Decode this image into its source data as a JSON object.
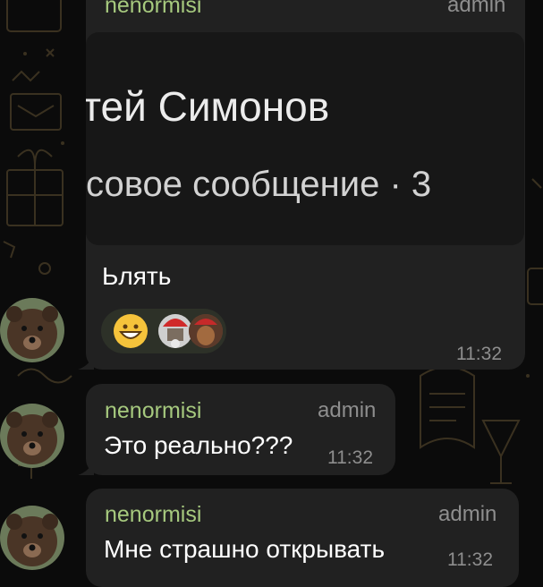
{
  "messages": [
    {
      "sender": "nenormisi",
      "role": "admin",
      "preview_name": "тей Симонов",
      "preview_subtitle": "совое сообщение · 3",
      "text": "Ьлять",
      "reaction_icons": [
        "grinning-face-icon",
        "reaction-avatar-1",
        "reaction-avatar-2"
      ],
      "time": "11:32"
    },
    {
      "sender": "nenormisi",
      "role": "admin",
      "text": "Это реально???",
      "time": "11:32"
    },
    {
      "sender": "nenormisi",
      "role": "admin",
      "text": "Мне страшно открывать",
      "time": "11:32"
    }
  ],
  "colors": {
    "background": "#0b0b0b",
    "bubble": "#212121",
    "sender_name": "#a6c97e",
    "meta": "#8e8e8e",
    "reaction_pill": "#2d3128"
  }
}
